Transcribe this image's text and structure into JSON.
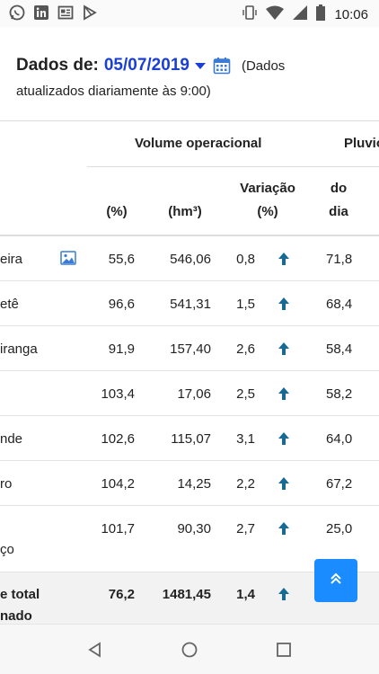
{
  "status_bar": {
    "time": "10:06",
    "left_icons": [
      "whatsapp-icon",
      "linkedin-icon",
      "news-icon",
      "play-store-icon"
    ],
    "right_icons": [
      "vibrate-icon",
      "wifi-icon",
      "signal-icon",
      "battery-icon"
    ]
  },
  "header": {
    "label": "Dados de:",
    "date": "05/07/2019",
    "note_line1": "(Dados",
    "note_line2": "atualizados diariamente às 9:00)"
  },
  "table": {
    "group_headers": {
      "volume": "Volume operacional",
      "pluvio": "Pluvio"
    },
    "columns": {
      "pct": "(%)",
      "hm": "(hm³)",
      "var_line1": "Variação",
      "var_line2": "(%)",
      "dia_line1": "do",
      "dia_line2": "dia"
    },
    "rows": [
      {
        "name": "eira",
        "pct": "55,6",
        "hm": "546,06",
        "var": "0,8",
        "dia": "71,8"
      },
      {
        "name": "etê",
        "pct": "96,6",
        "hm": "541,31",
        "var": "1,5",
        "dia": "68,4"
      },
      {
        "name": "iranga",
        "pct": "91,9",
        "hm": "157,40",
        "var": "2,6",
        "dia": "58,4"
      },
      {
        "name": "",
        "pct": "103,4",
        "hm": "17,06",
        "var": "2,5",
        "dia": "58,2"
      },
      {
        "name": "nde",
        "pct": "102,6",
        "hm": "115,07",
        "var": "3,1",
        "dia": "64,0"
      },
      {
        "name": "ro",
        "pct": "104,2",
        "hm": "14,25",
        "var": "2,2",
        "dia": "67,2"
      },
      {
        "name": "ço",
        "pct": "101,7",
        "hm": "90,30",
        "var": "2,7",
        "dia": "25,0"
      }
    ],
    "total": {
      "name_line1": "e total",
      "name_line2": "nado",
      "pct": "76,2",
      "hm": "1481,45",
      "var": "1,4"
    }
  },
  "colors": {
    "accent": "#1a3fd6",
    "arrow": "#176a94",
    "fab": "#1a8cff"
  }
}
